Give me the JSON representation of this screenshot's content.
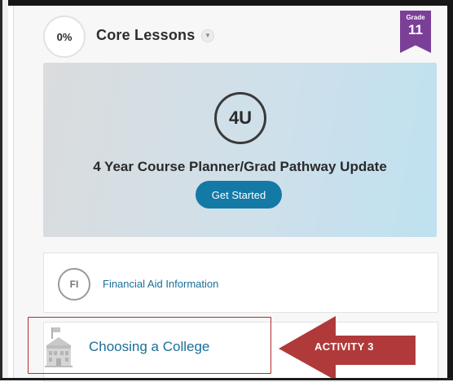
{
  "header": {
    "progress": "0%",
    "title": "Core Lessons",
    "grade_label": "Grade",
    "grade_value": "11"
  },
  "feature": {
    "badge": "4U",
    "title": "4 Year Course Planner/Grad Pathway Update",
    "button_label": "Get Started"
  },
  "lessons": [
    {
      "icon_text": "FI",
      "label": "Financial Aid Information"
    },
    {
      "icon": "school-building-icon",
      "label": "Choosing a College"
    }
  ],
  "annotation": {
    "label": "ACTIVITY 3",
    "color": "#b03a3a"
  },
  "colors": {
    "accent_blue": "#1479a5",
    "grade_purple": "#7b3f98",
    "link_blue": "#1a6f98"
  }
}
